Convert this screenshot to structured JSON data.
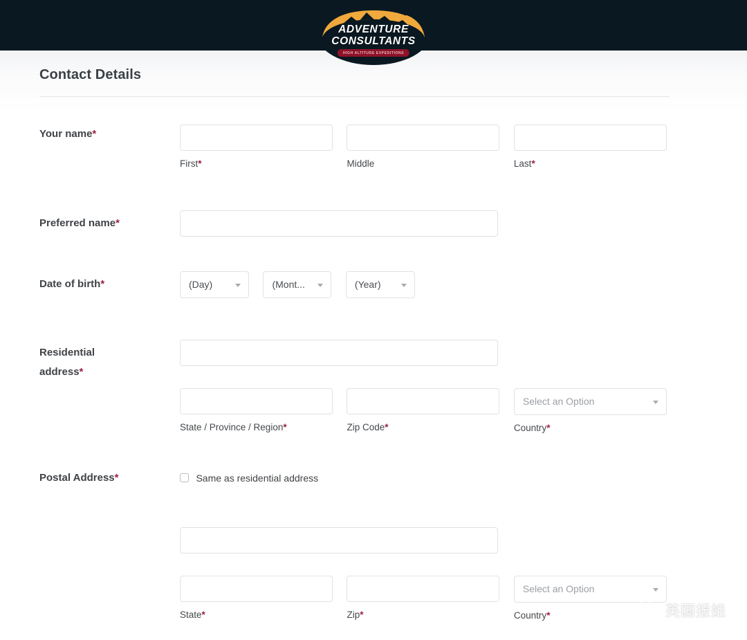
{
  "header": {
    "logo": {
      "line1": "ADVENTURE",
      "line2": "CONSULTANTS",
      "badge": "HIGH ALTITUDE EXPEDITIONS",
      "arc_color": "#f0a93c",
      "bg_color": "#0a1821",
      "badge_color": "#8d1228"
    }
  },
  "form": {
    "title": "Contact Details",
    "required_mark": "*",
    "accent_required_color": "#9c1f3d",
    "select_placeholder": "Select an Option",
    "rows": {
      "your_name": {
        "label": "Your name",
        "required": true,
        "first": {
          "value": "",
          "sublabel": "First",
          "required": true
        },
        "middle": {
          "value": "",
          "sublabel": "Middle",
          "required": false
        },
        "last": {
          "value": "",
          "sublabel": "Last",
          "required": true
        }
      },
      "preferred_name": {
        "label": "Preferred name",
        "required": true,
        "value": ""
      },
      "date_of_birth": {
        "label": "Date of birth",
        "required": true,
        "day": "(Day)",
        "month": "(Mont...",
        "year": "(Year)"
      },
      "residential_address": {
        "label_line1": "Residential",
        "label_line2": "address",
        "required": true,
        "street": {
          "value": ""
        },
        "state": {
          "value": "",
          "sublabel": "State / Province / Region",
          "required": true
        },
        "zip": {
          "value": "",
          "sublabel": "Zip Code",
          "required": true
        },
        "country": {
          "value": "Select an Option",
          "sublabel": "Country",
          "required": true
        }
      },
      "postal_address": {
        "label": "Postal Address",
        "required": true,
        "same_as_residential": {
          "label": "Same as residential address",
          "checked": false
        },
        "street": {
          "value": ""
        },
        "state": {
          "value": "",
          "sublabel": "State",
          "required": true
        },
        "zip": {
          "value": "",
          "sublabel": "Zip",
          "required": true
        },
        "country": {
          "value": "Select an Option",
          "sublabel": "Country",
          "required": true
        }
      }
    }
  },
  "watermark": {
    "text": "英国报姐",
    "icon": "wechat-icon"
  }
}
